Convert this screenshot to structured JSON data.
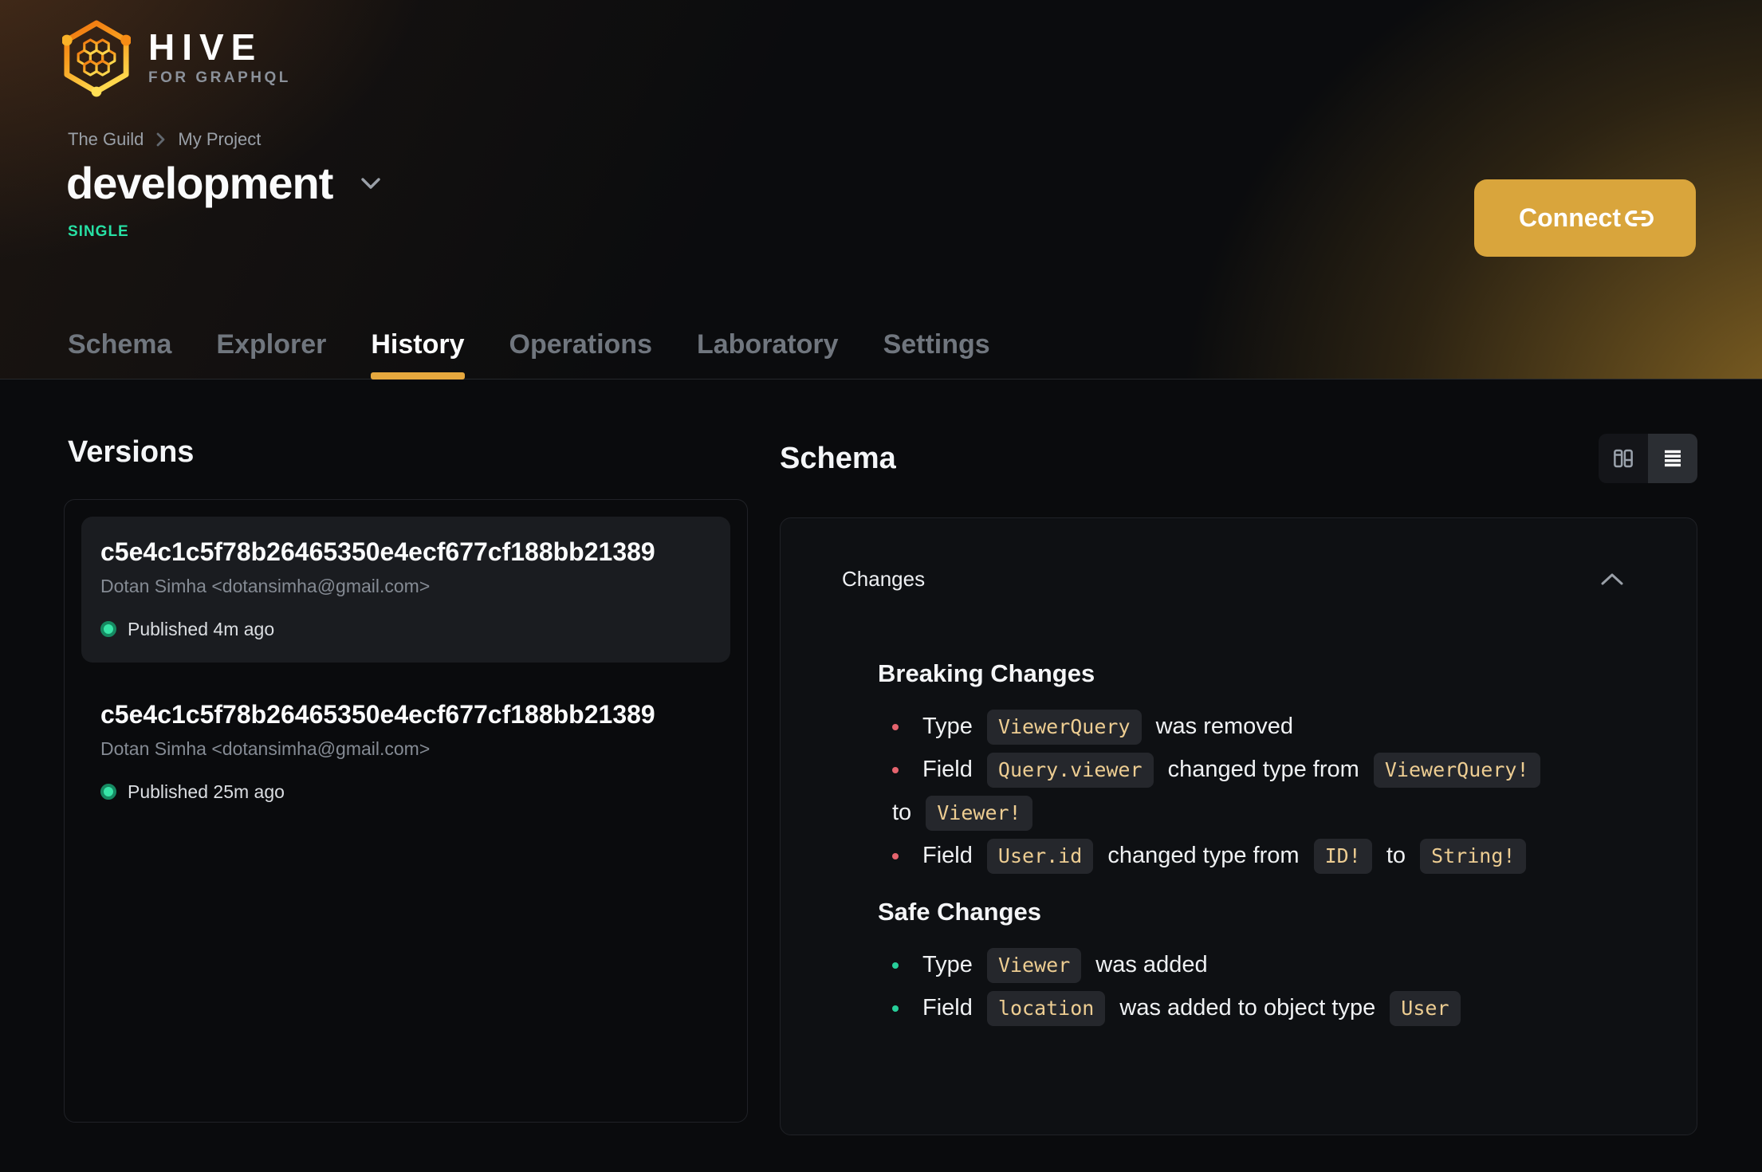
{
  "brand": {
    "name": "HIVE",
    "tagline": "FOR GRAPHQL"
  },
  "breadcrumb": {
    "items": [
      "The Guild",
      "My Project"
    ]
  },
  "target": {
    "title": "development",
    "badge": "SINGLE"
  },
  "connect": {
    "label": "Connect"
  },
  "tabs": {
    "items": [
      {
        "label": "Schema",
        "active": false
      },
      {
        "label": "Explorer",
        "active": false
      },
      {
        "label": "History",
        "active": true
      },
      {
        "label": "Operations",
        "active": false
      },
      {
        "label": "Laboratory",
        "active": false
      },
      {
        "label": "Settings",
        "active": false
      }
    ]
  },
  "versions": {
    "heading": "Versions",
    "items": [
      {
        "hash": "c5e4c1c5f78b26465350e4ecf677cf188bb21389",
        "author": "Dotan Simha <dotansimha@gmail.com>",
        "status": "Published 4m ago",
        "selected": true
      },
      {
        "hash": "c5e4c1c5f78b26465350e4ecf677cf188bb21389",
        "author": "Dotan Simha <dotansimha@gmail.com>",
        "status": "Published 25m ago",
        "selected": false
      }
    ]
  },
  "schema_panel": {
    "heading": "Schema",
    "changes_label": "Changes",
    "view_modes": [
      "diff-view",
      "list-view"
    ],
    "active_view": "list-view"
  },
  "changes": {
    "sections": [
      {
        "title": "Breaking Changes",
        "bullet_color": "#e5646e",
        "items": [
          {
            "segments": [
              {
                "t": "text",
                "v": "Type"
              },
              {
                "t": "code",
                "v": "ViewerQuery"
              },
              {
                "t": "text",
                "v": "was removed"
              }
            ]
          },
          {
            "segments": [
              {
                "t": "text",
                "v": "Field"
              },
              {
                "t": "code",
                "v": "Query.viewer"
              },
              {
                "t": "text",
                "v": "changed type from"
              },
              {
                "t": "code",
                "v": "ViewerQuery!"
              },
              {
                "t": "text",
                "v": "to"
              },
              {
                "t": "code",
                "v": "Viewer!"
              }
            ],
            "break_after": 3
          },
          {
            "segments": [
              {
                "t": "text",
                "v": "Field"
              },
              {
                "t": "code",
                "v": "User.id"
              },
              {
                "t": "text",
                "v": "changed type from"
              },
              {
                "t": "code",
                "v": "ID!"
              },
              {
                "t": "text",
                "v": "to"
              },
              {
                "t": "code",
                "v": "String!"
              }
            ]
          }
        ]
      },
      {
        "title": "Safe Changes",
        "bullet_color": "#27cf9a",
        "items": [
          {
            "segments": [
              {
                "t": "text",
                "v": "Type"
              },
              {
                "t": "code",
                "v": "Viewer"
              },
              {
                "t": "text",
                "v": "was added"
              }
            ]
          },
          {
            "segments": [
              {
                "t": "text",
                "v": "Field"
              },
              {
                "t": "code",
                "v": "location"
              },
              {
                "t": "text",
                "v": "was added to object type"
              },
              {
                "t": "code",
                "v": "User"
              }
            ]
          }
        ]
      }
    ]
  },
  "colors": {
    "accent": "#d9a53c",
    "tab_underline": "#e6a83e",
    "badge_green": "#27e0a4",
    "chip_text": "#edcd92",
    "breaking_bullet": "#e5646e",
    "safe_bullet": "#27cf9a",
    "status_dot": "#38e5a8"
  },
  "icons": {
    "logo": "hive-hexagon-honeycomb",
    "breadcrumb_sep": "chevron-right",
    "target_dropdown": "chevron-down",
    "connect": "link",
    "view_left": "diff-columns",
    "view_right": "list-lines",
    "changes_collapse": "chevron-up",
    "version_status": "green-dot"
  }
}
